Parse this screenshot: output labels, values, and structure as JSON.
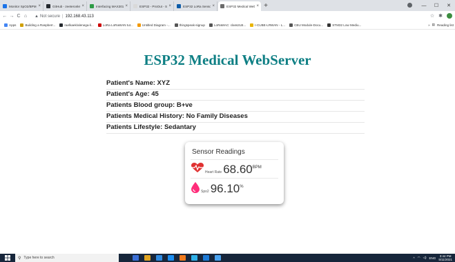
{
  "browser": {
    "tabs": [
      {
        "title": "Monitor SpO2/BPM with ESP",
        "color": "#1a73e8",
        "active": false
      },
      {
        "title": "GitHub - zeeteronks/esp32-",
        "color": "#24292e",
        "active": false
      },
      {
        "title": "Interfacing MAX30100 Pulse",
        "color": "#2e9b46",
        "active": false
      },
      {
        "title": "ESP32 - ProOut - StudioPieter",
        "color": "#d9d9d9",
        "active": false
      },
      {
        "title": "ESP32 LoRa Sensor Monitorin",
        "color": "#0d5ca8",
        "active": false
      },
      {
        "title": "ESP32 Medical WebServer",
        "color": "#6b6b6b",
        "active": true
      }
    ],
    "new_tab": "+",
    "window_controls": [
      "—",
      "☐",
      "✕"
    ],
    "security_label": "Not secure",
    "url": "192.168.43.113",
    "bookmarks": [
      {
        "label": "Apps",
        "color": "#4285f4"
      },
      {
        "label": "Building a Raspberr...",
        "color": "#d0a000"
      },
      {
        "label": "raelkaek/alenega-li...",
        "color": "#24292e"
      },
      {
        "label": "LoRa LoRaWAN tut...",
        "color": "#cc0000"
      },
      {
        "label": "Untitled Diagram -...",
        "color": "#f29900"
      },
      {
        "label": "thingspeak-signup",
        "color": "#555555"
      },
      {
        "label": "LoRaMAC: class2LB...",
        "color": "#555555"
      },
      {
        "label": "I-CUBE-LRWAN - L...",
        "color": "#e8b400"
      },
      {
        "label": "CBU Module-Docu...",
        "color": "#555555"
      },
      {
        "label": "STM32 Low Mediu...",
        "color": "#333333"
      }
    ],
    "reading_list": "Reading list"
  },
  "page": {
    "title": "ESP32 Medical WebServer",
    "title_color": "#0e7f84",
    "patient_info": [
      {
        "label": "Patient's Name: ",
        "value": "XYZ"
      },
      {
        "label": "Patient's Age: ",
        "value": "45"
      },
      {
        "label": "Patients Blood group: ",
        "value": "B+ve"
      },
      {
        "label": "Patients Medical History: ",
        "value": "No Family Diseases"
      },
      {
        "label": "Patients Lifestyle: ",
        "value": "Sedantary"
      }
    ],
    "sensor_card": {
      "title": "Sensor Readings",
      "heart_rate": {
        "label": "Heart Rate",
        "value": "68.60",
        "unit": "BPM",
        "icon": "heartbeat-icon",
        "icon_color": "#e03131"
      },
      "spo2": {
        "label": "Spo2",
        "value": "96.10",
        "unit": "%",
        "icon": "drop-icon",
        "icon_color": "#ff2d7a"
      }
    }
  },
  "taskbar": {
    "search_placeholder": "Type here to search",
    "apps": [
      "#3b6fd6",
      "#e0a422",
      "#2f8ae0",
      "#1b8ef2",
      "#f07a1c",
      "#2fb0e8",
      "#1c7ad6",
      "#4aa3f0"
    ],
    "time": "3:44 PM",
    "date": "5/11/2021",
    "tray_text": "ENG"
  }
}
